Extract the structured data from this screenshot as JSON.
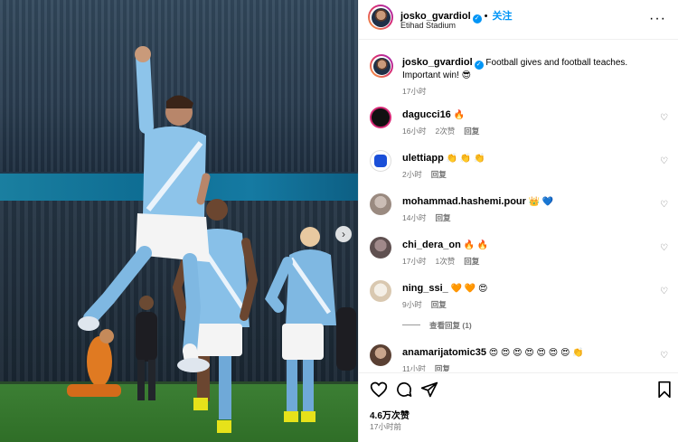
{
  "post": {
    "author": "josko_gvardiol",
    "follow_label": "关注",
    "dot": "•",
    "location": "Etihad Stadium",
    "verified_icon": "verified-badge-icon",
    "more_icon": "more-options-icon"
  },
  "caption": {
    "author": "josko_gvardiol",
    "text": "Football gives and football teaches. Important win! 😎",
    "time": "17小时"
  },
  "comments": [
    {
      "user": "dagucci16",
      "text": "🔥",
      "time": "16小时",
      "likes": "2次赞",
      "reply": "回复",
      "avatar_color": "#111111"
    },
    {
      "user": "ulettiapp",
      "text": "👏 👏 👏",
      "time": "2小时",
      "likes": "",
      "reply": "回复",
      "avatar_color": "#1a4fd8"
    },
    {
      "user": "mohammad.hashemi.pour",
      "text": "👑 💙",
      "time": "14小时",
      "likes": "",
      "reply": "回复",
      "avatar_color": "#b8a9a0"
    },
    {
      "user": "chi_dera_on",
      "text": "🔥 🔥",
      "time": "17小时",
      "likes": "1次赞",
      "reply": "回复",
      "avatar_color": "#7a6a6a"
    },
    {
      "user": "ning_ssi_",
      "text": "🧡 🧡 😍",
      "time": "9小时",
      "likes": "",
      "reply": "回复",
      "avatar_color": "#d9c8b0"
    },
    {
      "user": "anamarijatomic35",
      "text": "😍 😍 😍 😍 😍 😍 😍 👏",
      "time": "11小时",
      "likes": "",
      "reply": "回复",
      "avatar_color": "#8c6f5e"
    }
  ],
  "view_replies": "查看回复 (1)",
  "footer": {
    "likes": "4.6万次赞",
    "time_ago": "17小时前",
    "icons": [
      "heart-icon",
      "comment-icon",
      "share-icon",
      "bookmark-icon"
    ]
  },
  "colors": {
    "accent": "#0095f6",
    "muted": "#737373",
    "divider": "#efefef"
  }
}
